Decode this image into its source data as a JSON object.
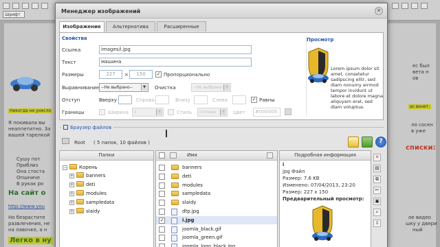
{
  "background": {
    "font_select": "Шрифт",
    "snippet_1": "Никогда не унесло",
    "snippet_2": "Я покивала вы",
    "snippet_3": "неаппетитно. За",
    "snippet_4": "вашей тарелкой",
    "bullets": [
      "Сушу пот",
      "Приблиз",
      "Она стоста",
      "Опшниче",
      "В рукак ро"
    ],
    "heading_1": "На сайт о",
    "link": "http://www.you",
    "snippet_5": "Но безрастите",
    "snippet_6": "развлечения, не",
    "snippet_7": "на лавочке, а н",
    "highlight_bottom": "Легко в ну",
    "right_1": "ес был",
    "right_2": "вета н",
    "right_3": "ов",
    "right_hl": "ас вонет.",
    "right_4": "ло сосен",
    "right_5": "в уже",
    "right_red": "списки:",
    "right_6": "ое видео",
    "right_7": "шку у двери",
    "right_8": "ный"
  },
  "dialog": {
    "title": "Менеджер изображений",
    "tabs": [
      "Изображение",
      "Альтернатива",
      "Расширенные"
    ],
    "properties": {
      "section": "Свойства",
      "url_label": "Ссылка",
      "url_value": "images/i.jpg",
      "alt_label": "Текст",
      "alt_value": "машина",
      "size_label": "Размеры",
      "width": "227",
      "times": "×",
      "height": "150",
      "proportional_label": "Пропорционально",
      "align_label": "Выравнивание",
      "align_value": "--Не выбрано--",
      "clear_label": "Очистка",
      "clear_value": "--Не выбрано--",
      "margin_label": "Отступ",
      "top_label": "Вверху",
      "right_label": "Справа",
      "bottom_label": "Внизу",
      "left_label": "Слева",
      "equal_label": "Равны",
      "border_label": "Границы",
      "border_width_label": "Ширина",
      "border_width_value": "1",
      "style_label": "Стиль",
      "style_value": "сплошн",
      "color_label": "Цвет",
      "color_value": "#000000"
    },
    "preview": {
      "title": "Просмотр",
      "text": "Lorem ipsum dolor sit amet, consetetur sadipscing elitr, sed diam nonumy eirmod tempor invidunt ut labore et dolore magna aliquyam erat, sed diam voluptua."
    },
    "file_browser": {
      "title": "Браузер файлов",
      "root_label": "Root",
      "root_info": "( 5 папок, 10 файлов )",
      "folders_header": "Папки",
      "name_header": "Имя",
      "details_header": "Подробная информация",
      "tree_root": "Корень",
      "tree_folders": [
        "banners",
        "deti",
        "modules",
        "sampledata",
        "slaidy"
      ],
      "files": [
        {
          "name": "banners",
          "kind": "folder"
        },
        {
          "name": "deti",
          "kind": "folder"
        },
        {
          "name": "modules",
          "kind": "folder"
        },
        {
          "name": "sampledata",
          "kind": "folder"
        },
        {
          "name": "slaidy",
          "kind": "folder"
        },
        {
          "name": "dtp.jpg",
          "kind": "file"
        },
        {
          "name": "i.jpg",
          "kind": "file"
        },
        {
          "name": "joomla_black.gif",
          "kind": "file"
        },
        {
          "name": "joomla_green.gif",
          "kind": "file"
        },
        {
          "name": "joomla_logo_black.jpg",
          "kind": "file"
        }
      ],
      "details": {
        "name": "i",
        "type": "jpg Файл",
        "size": "Размер: 7.6 KB",
        "modified": "Изменено: 07/04/2013, 23:20",
        "dimensions": "Размер: 227 x 150",
        "preview_label": "Предварительный просмотр:"
      }
    }
  },
  "colors": {
    "accent": "#2554b0",
    "selected_row": "#dfe6f5",
    "folder": "#e0b23a"
  }
}
